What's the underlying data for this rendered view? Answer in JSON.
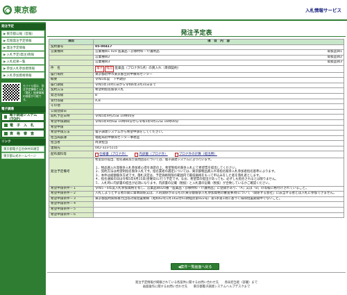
{
  "header": {
    "logo": "東京都",
    "system_title": "入札情報サービス"
  },
  "sidebar": {
    "section1": "発注予定",
    "items": [
      "東京都公報（官報）",
      "年間発注予定情報",
      "発注予定情報",
      "入札予定(発注)情報",
      "入札結果一覧",
      "参加入札参加者情報",
      "入札参加資格情報"
    ],
    "qr_note": "モバイル版は、発注予定情報と入札（落札）結果情報の検索が可能です。",
    "section2": "電子調達",
    "buttons": [
      "電子調達システム(TOP)",
      "電　子　入　札",
      "資　格　審　査"
    ],
    "section3": "リンク",
    "links": [
      "東京都電子自治体共同運営",
      "東京都公式ホームページ"
    ]
  },
  "main": {
    "title": "発注予定表",
    "col_item": "項目",
    "col_content": "項　目　内　容",
    "rows": [
      {
        "label": "契約番号",
        "value": "05-00417"
      },
      {
        "label": "営業種目",
        "value": "営業種目1 020 医薬品・診療材料・介護用品",
        "sub": "取扱品目1"
      },
      {
        "label": "",
        "value": "営業種目2",
        "sub": "取扱品目2"
      },
      {
        "label": "",
        "value": "営業種目3",
        "sub": "取扱品目3"
      },
      {
        "label": "件　名",
        "tags": [
          "電子",
          "経営"
        ],
        "value": "医薬品（プロナ外5点）の買入れ（単価契約）"
      },
      {
        "label": "履行場所",
        "value": "東京都府中市東京都立府中療育センター"
      },
      {
        "label": "概要",
        "value": "令和5年度　下半期分"
      },
      {
        "label": "履行期間",
        "value": "令和5年10月1日から令和6年3月31日まで"
      },
      {
        "label": "契約方法",
        "value": "希望制指名競争入札"
      },
      {
        "label": "発注等級",
        "value": "B"
      },
      {
        "label": "受付等級",
        "value": "A,B"
      },
      {
        "label": "その他",
        "value": ""
      },
      {
        "label": "公開登録日",
        "value": ""
      },
      {
        "label": "開札予定日時",
        "value": "令和5年9月25日 10時00分"
      },
      {
        "label": "希望申請期間",
        "value": "令和5年9月6日 10時00分から令和5年9月12日 16時00分"
      },
      {
        "label": "希望申請",
        "value": ""
      },
      {
        "label": "希望申請方法",
        "value": "電子調達システムから希望申請をしてください。"
      },
      {
        "label": "担当局部課",
        "value": "福祉局府中療育センター事務室"
      },
      {
        "label": "担当者",
        "value": "周渡担当"
      },
      {
        "label": "連絡先",
        "value": "042-323-5115"
      }
    ],
    "files_label": "配布資料等",
    "files": [
      "仕様書（プロナ外）",
      "内訳書（プロナ外）",
      "プロナ外の計算（提出用）"
    ],
    "notes_label": "発注予定備考",
    "notes": "希望票の提出、指名通知及び質問回答については、電子調達システムにより行います。\n\n１、物品買入れ等競争入札参加者心得を承諾の上、希望制指名競争入札にて希望票を提出してください。\n２、契約方法は希望制指名競争入札です。指名業者の選定については、東京都物品買入れ等指名競争入札参加者指名基準によります。\n３、本件は総額競争方式です。落札決定は、予定価格制限の範囲内で最低価格をもって申込みをした者を落札者とします。\n４、指名通知の日は令和5年9月15日(金曜日)に行う予定です。なお、希望票の提出があっても、必ずしも指名されるとは限りません。\n５、入札時に内訳書の提出が必須になります。内訳書の記載（税抜）と入札書の記載（税抜）が合致しているかご確認ください。",
    "cond_rows": [
      {
        "label": "希望申請条件－１",
        "value": "令和5・6年度入札参加資格を有し、営業品目020番「医薬品・診療材料・介護用品」に登録があり、「A」又は「B」の等級に格付けされていること。"
      },
      {
        "label": "希望申請条件－２",
        "value": "入札しようとする者の関に資本関係又は、人的関係があるもの(東京都競争入札参加資格の審査事項)について「関係する会社」に該当する者とは入札に参加できません。"
      },
      {
        "label": "希望申請条件－３",
        "value": "東京都契約関係暴力団等対策措置要綱（昭和62年1月14日付61財経庶第922号）第5条第1項に基づく排除措置期間中でないこと。"
      },
      {
        "label": "希望申請条件－４",
        "value": ""
      },
      {
        "label": "希望申請条件－５",
        "value": ""
      },
      {
        "label": "希望申請条件－６",
        "value": ""
      }
    ],
    "back_label": "◀案件一覧画面へ戻る",
    "footer_line1": "発注予定情報が掲載されている各案件に関するお問い合わせ先　　各局担当者（部署）まで",
    "footer_line2": "画面操作に関するお問い合わせ先　　東京都電子調達システムヘルプデスクまで"
  }
}
